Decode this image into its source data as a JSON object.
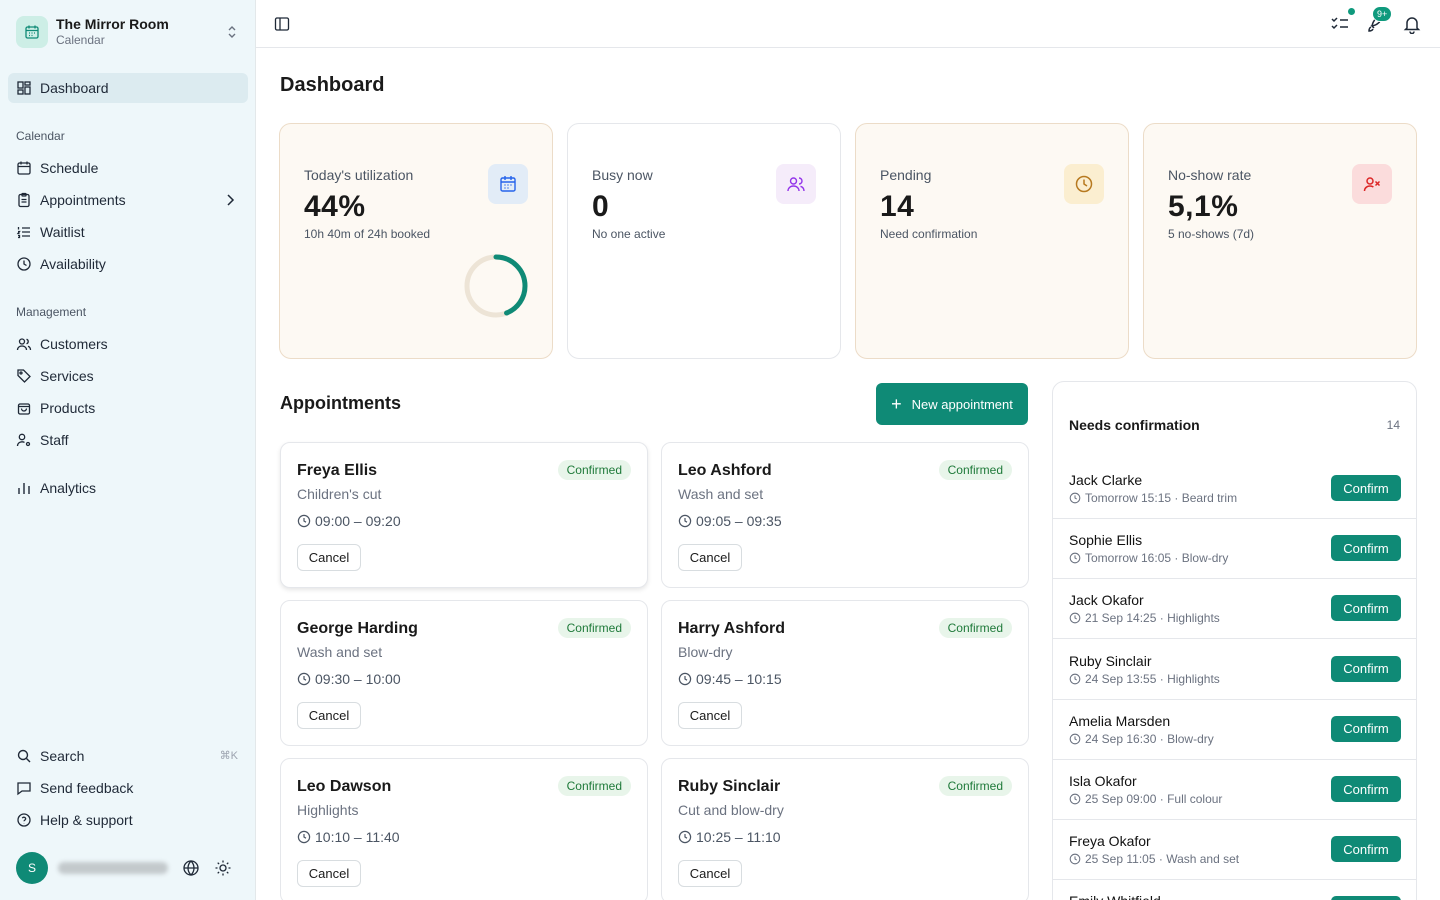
{
  "org": {
    "name": "The Mirror Room",
    "subtitle": "Calendar"
  },
  "nav": {
    "dashboard": "Dashboard",
    "calendar_label": "Calendar",
    "schedule": "Schedule",
    "appointments": "Appointments",
    "waitlist": "Waitlist",
    "availability": "Availability",
    "management_label": "Management",
    "customers": "Customers",
    "services": "Services",
    "products": "Products",
    "staff": "Staff",
    "analytics": "Analytics",
    "search": "Search",
    "search_shortcut": "⌘K",
    "feedback": "Send feedback",
    "help": "Help & support"
  },
  "user": {
    "initial": "S"
  },
  "topbar": {
    "notifications_badge": "9+"
  },
  "page": {
    "title": "Dashboard"
  },
  "stats": [
    {
      "label": "Today's utilization",
      "value": "44%",
      "sub": "10h 40m of 24h booked",
      "icon": "calendar-icon",
      "progress": 0.44
    },
    {
      "label": "Busy now",
      "value": "0",
      "sub": "No one active",
      "icon": "users-icon"
    },
    {
      "label": "Pending",
      "value": "14",
      "sub": "Need confirmation",
      "icon": "clock-icon"
    },
    {
      "label": "No-show rate",
      "value": "5,1%",
      "sub": "5 no-shows (7d)",
      "icon": "user-x-icon"
    }
  ],
  "appointments": {
    "title": "Appointments",
    "new_button": "New appointment",
    "cancel_label": "Cancel",
    "items": [
      {
        "name": "Freya Ellis",
        "service": "Children's cut",
        "time": "09:00 – 09:20",
        "status": "Confirmed"
      },
      {
        "name": "Leo Ashford",
        "service": "Wash and set",
        "time": "09:05 – 09:35",
        "status": "Confirmed"
      },
      {
        "name": "George Harding",
        "service": "Wash and set",
        "time": "09:30 – 10:00",
        "status": "Confirmed"
      },
      {
        "name": "Harry Ashford",
        "service": "Blow-dry",
        "time": "09:45 – 10:15",
        "status": "Confirmed"
      },
      {
        "name": "Leo Dawson",
        "service": "Highlights",
        "time": "10:10 – 11:40",
        "status": "Confirmed"
      },
      {
        "name": "Ruby Sinclair",
        "service": "Cut and blow-dry",
        "time": "10:25 – 11:10",
        "status": "Confirmed"
      }
    ]
  },
  "needs_confirmation": {
    "title": "Needs confirmation",
    "count": "14",
    "confirm_label": "Confirm",
    "items": [
      {
        "name": "Jack Clarke",
        "when": "Tomorrow 15:15",
        "service": "Beard trim"
      },
      {
        "name": "Sophie Ellis",
        "when": "Tomorrow 16:05",
        "service": "Blow-dry"
      },
      {
        "name": "Jack Okafor",
        "when": "21 Sep 14:25",
        "service": "Highlights"
      },
      {
        "name": "Ruby Sinclair",
        "when": "24 Sep 13:55",
        "service": "Highlights"
      },
      {
        "name": "Amelia Marsden",
        "when": "24 Sep 16:30",
        "service": "Blow-dry"
      },
      {
        "name": "Isla Okafor",
        "when": "25 Sep 09:00",
        "service": "Full colour"
      },
      {
        "name": "Freya Okafor",
        "when": "25 Sep 11:05",
        "service": "Wash and set"
      },
      {
        "name": "Emily Whitfield",
        "when": "",
        "service": ""
      }
    ]
  },
  "colors": {
    "accent": "#0f8a76",
    "sidebar_bg": "#eef7fa",
    "confirmed_bg": "#e8f5ea",
    "confirmed_text": "#1f7a3a"
  }
}
